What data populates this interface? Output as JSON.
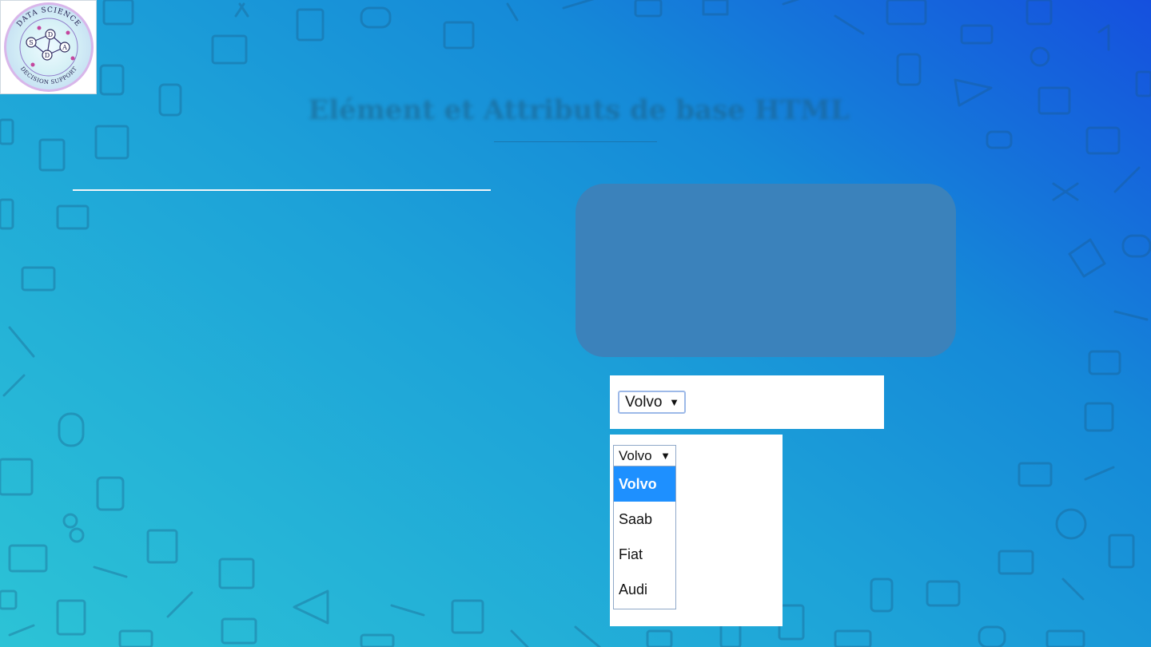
{
  "slide": {
    "title": "Elément et Attributs de base HTML"
  },
  "logo": {
    "top_text": "DATA SCIENCE",
    "bottom_text": "DECISION SUPPORT",
    "letters": [
      "S",
      "D",
      "A",
      "D"
    ]
  },
  "select_closed": {
    "value": "Volvo"
  },
  "select_open": {
    "value": "Volvo",
    "options": [
      "Volvo",
      "Saab",
      "Fiat",
      "Audi"
    ],
    "highlighted_index": 0
  },
  "colors": {
    "panel": "#3b82bb",
    "option_highlight": "#1e90ff",
    "background_start": "#2cc3d6",
    "background_end": "#1550de"
  }
}
